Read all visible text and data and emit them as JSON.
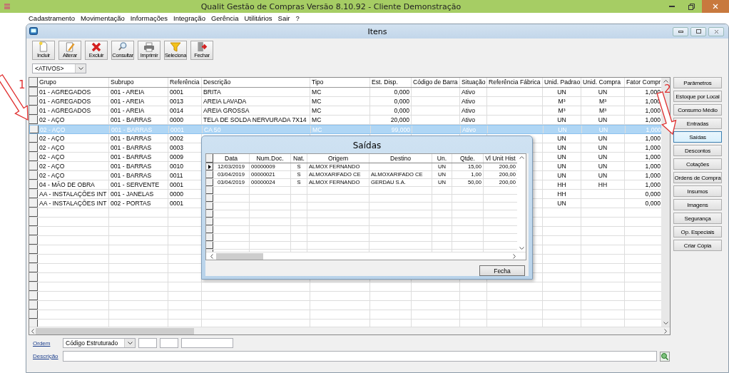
{
  "app_title": "Qualit Gestão de Compras Versão 8.10.92 - Cliente Demonstração",
  "menu": [
    "Cadastramento",
    "Movimentação",
    "Informações",
    "Integração",
    "Gerência",
    "Utilitários",
    "Sair",
    "?"
  ],
  "window": {
    "title": "Itens"
  },
  "toolbar": [
    {
      "label": "Incluir",
      "kind": "new"
    },
    {
      "label": "Alterar",
      "kind": "edit"
    },
    {
      "label": "Excluir",
      "kind": "delete"
    },
    {
      "label": "Consultar",
      "kind": "view"
    },
    {
      "label": "Imprimir",
      "kind": "print"
    },
    {
      "label": "Seleciona",
      "kind": "filter"
    },
    {
      "label": "Fechar",
      "kind": "exit"
    }
  ],
  "filter": {
    "value": "<ATIVOS>"
  },
  "table": {
    "columns": [
      "Grupo",
      "Subrupo",
      "Referência",
      "Descrição",
      "Tipo",
      "Est. Disp.",
      "Código de Barra",
      "Situação",
      "Referência Fábrica",
      "Unid. Padrao",
      "Unid. Compra",
      "Fator Compr"
    ],
    "rows": [
      {
        "selected": false,
        "cells": {
          "grupo": "01 - AGREGADOS",
          "subrupo": "001 - AREIA",
          "referencia": "0001",
          "descricao": "BRITA",
          "tipo": "MC",
          "est_disp": "0,000",
          "situacao": "Ativo",
          "unid_padrao": "UN",
          "unid_compra": "UN",
          "fator_compra": "1,000"
        }
      },
      {
        "selected": false,
        "cells": {
          "grupo": "01 - AGREGADOS",
          "subrupo": "001 - AREIA",
          "referencia": "0013",
          "descricao": "AREIA LAVADA",
          "tipo": "MC",
          "est_disp": "0,000",
          "situacao": "Ativo",
          "unid_padrao": "M³",
          "unid_compra": "M³",
          "fator_compra": "1,000"
        }
      },
      {
        "selected": false,
        "cells": {
          "grupo": "01 - AGREGADOS",
          "subrupo": "001 - AREIA",
          "referencia": "0014",
          "descricao": "AREIA GROSSA",
          "tipo": "MC",
          "est_disp": "0,000",
          "situacao": "Ativo",
          "unid_padrao": "M³",
          "unid_compra": "M³",
          "fator_compra": "1,000"
        }
      },
      {
        "selected": false,
        "cells": {
          "grupo": "02 - AÇO",
          "subrupo": "001 - BARRAS",
          "referencia": "0000",
          "descricao": "TELA DE SOLDA NERVURADA 7X14",
          "tipo": "MC",
          "est_disp": "20,000",
          "situacao": "Ativo",
          "unid_padrao": "UN",
          "unid_compra": "UN",
          "fator_compra": "1,000"
        }
      },
      {
        "selected": true,
        "cells": {
          "grupo": "02 - AÇO",
          "subrupo": "001 - BARRAS",
          "referencia": "0001",
          "descricao": "CA 50",
          "tipo": "MC",
          "est_disp": "99,000",
          "situacao": "Ativo",
          "unid_padrao": "UN",
          "unid_compra": "UN",
          "fator_compra": "1,000"
        }
      },
      {
        "selected": false,
        "cells": {
          "grupo": "02 - AÇO",
          "subrupo": "001 - BARRAS",
          "referencia": "0002",
          "unid_padrao": "UN",
          "unid_compra": "UN",
          "fator_compra": "1,000"
        }
      },
      {
        "selected": false,
        "cells": {
          "grupo": "02 - AÇO",
          "subrupo": "001 - BARRAS",
          "referencia": "0003",
          "unid_padrao": "UN",
          "unid_compra": "UN",
          "fator_compra": "1,000"
        }
      },
      {
        "selected": false,
        "cells": {
          "grupo": "02 - AÇO",
          "subrupo": "001 - BARRAS",
          "referencia": "0009",
          "unid_padrao": "UN",
          "unid_compra": "UN",
          "fator_compra": "1,000"
        }
      },
      {
        "selected": false,
        "cells": {
          "grupo": "02 - AÇO",
          "subrupo": "001 - BARRAS",
          "referencia": "0010",
          "unid_padrao": "UN",
          "unid_compra": "UN",
          "fator_compra": "1,000"
        }
      },
      {
        "selected": false,
        "cells": {
          "grupo": "02 - AÇO",
          "subrupo": "001 - BARRAS",
          "referencia": "0011",
          "unid_padrao": "UN",
          "unid_compra": "UN",
          "fator_compra": "1,000"
        }
      },
      {
        "selected": false,
        "cells": {
          "grupo": "04 - MÃO DE OBRA",
          "subrupo": "001 - SERVENTE",
          "referencia": "0001",
          "unid_padrao": "HH",
          "unid_compra": "HH",
          "fator_compra": "1,000"
        }
      },
      {
        "selected": false,
        "cells": {
          "grupo": "AA - INSTALAÇÕES INT",
          "subrupo": "001 - JANELAS",
          "referencia": "0000",
          "unid_padrao": "HH",
          "fator_compra": "0,000"
        }
      },
      {
        "selected": false,
        "cells": {
          "grupo": "AA - INSTALAÇÕES INT",
          "subrupo": "002 - PORTAS",
          "referencia": "0001",
          "unid_padrao": "UN",
          "fator_compra": "0,000"
        }
      }
    ]
  },
  "side_buttons": [
    {
      "label": "Parâmetros",
      "selected": false
    },
    {
      "label": "Estoque por Local",
      "selected": false
    },
    {
      "label": "Consumo Médio",
      "selected": false
    },
    {
      "label": "Entradas",
      "selected": false
    },
    {
      "label": "Saídas",
      "selected": true
    },
    {
      "label": "Descontos",
      "selected": false
    },
    {
      "label": "Cotações",
      "selected": false
    },
    {
      "label": "Ordens de Compra",
      "selected": false
    },
    {
      "label": "Insumos",
      "selected": false
    },
    {
      "label": "Imagens",
      "selected": false
    },
    {
      "label": "Segurança",
      "selected": false
    },
    {
      "label": "Op. Especiais",
      "selected": false
    },
    {
      "label": "Criar Cópia",
      "selected": false
    }
  ],
  "dialog": {
    "title": "Saídas",
    "columns": [
      "Data",
      "Num.Doc.",
      "Nat.",
      "Origem",
      "Destino",
      "Un.",
      "Qtde.",
      "Vl Unit Hist"
    ],
    "rows": [
      {
        "selected": true,
        "cells": {
          "data": "12/03/2019",
          "num_doc": "00000009",
          "nat": "S",
          "origem": "ALMOX FERNANDO",
          "un": "UN",
          "qtde": "15,00",
          "vl_unit_hist": "200,00"
        }
      },
      {
        "selected": false,
        "cells": {
          "data": "03/04/2019",
          "num_doc": "00000021",
          "nat": "S",
          "origem": "ALMOXARIFADO CE",
          "destino": "ALMOXARIFADO CE",
          "un": "UN",
          "qtde": "1,00",
          "vl_unit_hist": "200,00"
        }
      },
      {
        "selected": false,
        "cells": {
          "data": "03/04/2019",
          "num_doc": "00000024",
          "nat": "S",
          "origem": "ALMOX FERNANDO",
          "destino": "GERDAU S.A.",
          "un": "UN",
          "qtde": "50,00",
          "vl_unit_hist": "200,00"
        }
      }
    ],
    "button": "Fecha"
  },
  "footer": {
    "order_label": "Ordem",
    "order_value": "Código Estruturado",
    "description_label": "Descrição"
  },
  "annotations": [
    {
      "label": "1"
    },
    {
      "label": "2"
    }
  ]
}
